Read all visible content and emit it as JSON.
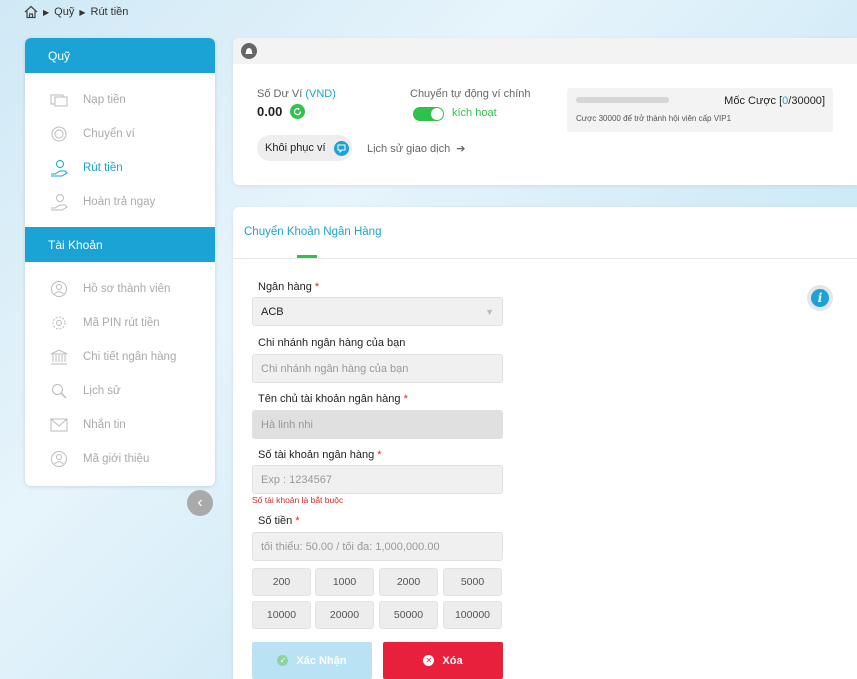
{
  "breadcrumb": {
    "items": [
      "Quỹ",
      "Rút tiền"
    ]
  },
  "sidebar": {
    "section1_title": "Quỹ",
    "section1_items": [
      {
        "label": "Nạp tiền",
        "icon": "deposit-icon"
      },
      {
        "label": "Chuyển ví",
        "icon": "transfer-icon"
      },
      {
        "label": "Rút tiền",
        "icon": "withdraw-icon",
        "active": true
      },
      {
        "label": "Hoàn trả ngay",
        "icon": "rebate-icon"
      }
    ],
    "section2_title": "Tài Khoản",
    "section2_items": [
      {
        "label": "Hồ sơ thành viên",
        "icon": "profile-icon"
      },
      {
        "label": "Mã PIN rút tiền",
        "icon": "pin-icon"
      },
      {
        "label": "Chi tiết ngân hàng",
        "icon": "bank-icon"
      },
      {
        "label": "Lịch sử",
        "icon": "history-icon"
      },
      {
        "label": "Nhắn tin",
        "icon": "message-icon"
      },
      {
        "label": "Mã giới thiệu",
        "icon": "referral-icon"
      }
    ]
  },
  "wallet": {
    "label": "Số Dư Ví",
    "unit": "(VND)",
    "balance": "0.00",
    "auto_transfer_label": "Chuyển tự động ví chính",
    "toggle_label": "kích hoạt",
    "toggle_on": true,
    "bet_title_prefix": "Mốc Cược [",
    "bet_current": "0",
    "bet_target": "/30000",
    "bet_title_suffix": "]",
    "bet_progress": 0,
    "bet_subtitle": "Cược 30000 để trở thành hội viên cấp VIP1",
    "restore_label": "Khôi phục ví",
    "history_label": "Lịch sử giao dịch"
  },
  "form": {
    "tab_label": "Chuyển Khoản Ngân Hàng",
    "bank_label": "Ngân hàng",
    "bank_value": "ACB",
    "branch_label": "Chi nhánh ngân hàng của bạn",
    "branch_placeholder": "Chi nhánh ngân hàng của bạn",
    "holder_label": "Tên chủ tài khoản ngân hàng",
    "holder_value": "Hà linh nhi",
    "account_label": "Số tài khoản ngân hàng",
    "account_placeholder": "Exp : 1234567",
    "account_error": "Số tài khoản là bắt buộc",
    "amount_label": "Số tiền",
    "amount_placeholder": "tối thiểu: 50.00 / tối đa: 1,000,000.00",
    "quick_amounts": [
      "200",
      "1000",
      "2000",
      "5000",
      "10000",
      "20000",
      "50000",
      "100000"
    ],
    "required_mark": "*",
    "confirm_label": "Xác Nhận",
    "clear_label": "Xóa"
  },
  "colors": {
    "accent": "#1aa3d4",
    "green": "#2fc24a",
    "danger": "#e8203c"
  }
}
